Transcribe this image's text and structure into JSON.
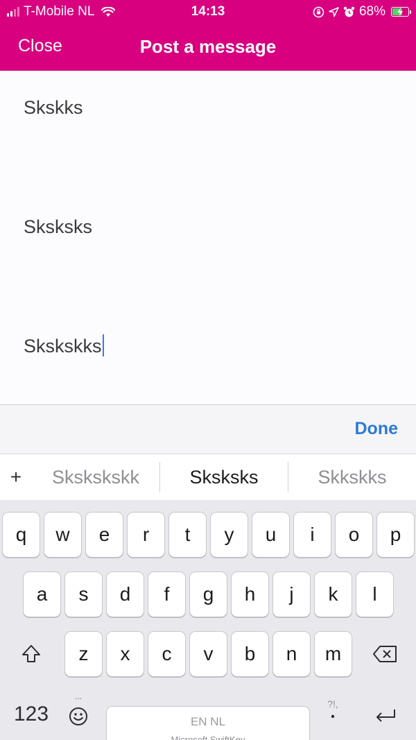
{
  "status_bar": {
    "carrier": "T-Mobile NL",
    "time": "14:13",
    "battery_percent": "68%",
    "battery_level": 0.68,
    "icons": [
      "signal-icon",
      "wifi-icon",
      "orientation-lock-icon",
      "location-icon",
      "alarm-icon",
      "battery-charging-icon"
    ]
  },
  "nav": {
    "close_label": "Close",
    "title": "Post a message"
  },
  "message": {
    "lines": [
      "Skskks",
      "Sksksks",
      "Skskskks"
    ]
  },
  "accessory": {
    "done_label": "Done"
  },
  "suggestions": {
    "plus": "+",
    "items": [
      "Skskskskk",
      "Sksksks",
      "Skkskks"
    ]
  },
  "keyboard": {
    "row1": [
      "q",
      "w",
      "e",
      "r",
      "t",
      "y",
      "u",
      "i",
      "o",
      "p"
    ],
    "row2": [
      "a",
      "s",
      "d",
      "f",
      "g",
      "h",
      "j",
      "k",
      "l"
    ],
    "row3": [
      "z",
      "x",
      "c",
      "v",
      "b",
      "n",
      "m"
    ],
    "numbers_label": "123",
    "space_language": "EN NL",
    "space_brand": "Microsoft SwiftKey",
    "emoji_hint": "...",
    "punctuation_hint": "?!,"
  },
  "colors": {
    "brand": "#d8007f",
    "accent": "#2b7ad6",
    "caret": "#3478f6"
  }
}
